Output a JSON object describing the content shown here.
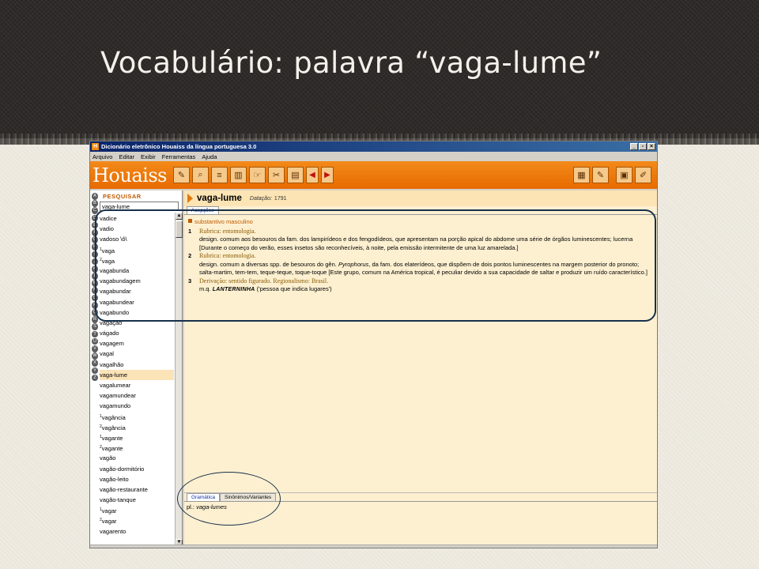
{
  "slide": {
    "title": "Vocabulário: palavra “vaga-lume”"
  },
  "window": {
    "title": "Dicionário eletrônico Houaiss da língua portuguesa 3.0",
    "controls": [
      "_",
      "▫",
      "×"
    ]
  },
  "menu": [
    "Arquivo",
    "Editar",
    "Exibir",
    "Ferramentas",
    "Ajuda"
  ],
  "toolbar": {
    "brand": "Houaiss"
  },
  "search": {
    "label": "PESQUISAR",
    "value": "vaga-lume"
  },
  "alphabet": [
    "A",
    "B",
    "C",
    "D",
    "E",
    "F",
    "G",
    "H",
    "I",
    "J",
    "K",
    "L",
    "M",
    "N",
    "O",
    "P",
    "Q",
    "R",
    "S",
    "T",
    "U",
    "V",
    "W",
    "X",
    "Y",
    "Z"
  ],
  "word_list": [
    {
      "sup": "",
      "word": "vadice"
    },
    {
      "sup": "",
      "word": "vadio"
    },
    {
      "sup": "",
      "word": "vadoso \\ô\\"
    },
    {
      "sup": "1",
      "word": "vaga"
    },
    {
      "sup": "2",
      "word": "vaga"
    },
    {
      "sup": "",
      "word": "vagabunda"
    },
    {
      "sup": "",
      "word": "vagabundagem"
    },
    {
      "sup": "",
      "word": "vagabundar"
    },
    {
      "sup": "",
      "word": "vagabundear"
    },
    {
      "sup": "",
      "word": "vagabundo"
    },
    {
      "sup": "",
      "word": "vagação"
    },
    {
      "sup": "",
      "word": "vágado"
    },
    {
      "sup": "",
      "word": "vagagem"
    },
    {
      "sup": "",
      "word": "vagal"
    },
    {
      "sup": "",
      "word": "vagalhão"
    },
    {
      "sup": "",
      "word": "vaga-lume",
      "selected": true
    },
    {
      "sup": "",
      "word": "vagalumear"
    },
    {
      "sup": "",
      "word": "vagamundear"
    },
    {
      "sup": "",
      "word": "vagamundo"
    },
    {
      "sup": "1",
      "word": "vagância"
    },
    {
      "sup": "2",
      "word": "vagância"
    },
    {
      "sup": "1",
      "word": "vagante"
    },
    {
      "sup": "2",
      "word": "vagante"
    },
    {
      "sup": "",
      "word": "vagão"
    },
    {
      "sup": "",
      "word": "vagão-dormitório"
    },
    {
      "sup": "",
      "word": "vagão-leito"
    },
    {
      "sup": "",
      "word": "vagão-restaurante"
    },
    {
      "sup": "",
      "word": "vagão-tanque"
    },
    {
      "sup": "1",
      "word": "vagar"
    },
    {
      "sup": "2",
      "word": "vagar"
    },
    {
      "sup": "",
      "word": "vagarento"
    }
  ],
  "entry": {
    "word": "vaga-lume",
    "date_label": "Datação:",
    "date": "1791",
    "tab": "Acepções",
    "pos": "substantivo masculino",
    "senses": [
      {
        "num": "1",
        "rubric": "Rubrica: entomologia.",
        "text": "design. comum aos besouros da fam. dos lampirídeos e dos fengodídeos, que apresentam na porção apical do abdome uma série de órgãos luminescentes; lucerna [Durante o começo do verão, esses insetos são reconhecíveis, à noite, pela emissão intermitente de uma luz amarelada.]"
      },
      {
        "num": "2",
        "rubric": "Rubrica: entomologia.",
        "text_before": "design. comum a diversas spp. de besouros do gên. ",
        "genus": "Pyrophorus",
        "text_after": ", da fam. dos elaterídeos, que dispõem de dois pontos luminescentes na margem posterior do pronoto; salta-martim, tem-tem, teque-teque, toque-toque [Este grupo, comum na América tropical, é peculiar devido a sua capacidade de saltar e produzir um ruído característico.]"
      },
      {
        "num": "3",
        "rubric": "Derivação: sentido figurado. Regionalismo: Brasil.",
        "mq": "m.q.",
        "ref": "LANTERNINHA",
        "gloss": "('pessoa que indica lugares')"
      }
    ]
  },
  "bottom": {
    "tabs": [
      "Gramática",
      "Sinônimos/Variantes"
    ],
    "plural_label": "pl.:",
    "plural": "vaga-lumes"
  }
}
